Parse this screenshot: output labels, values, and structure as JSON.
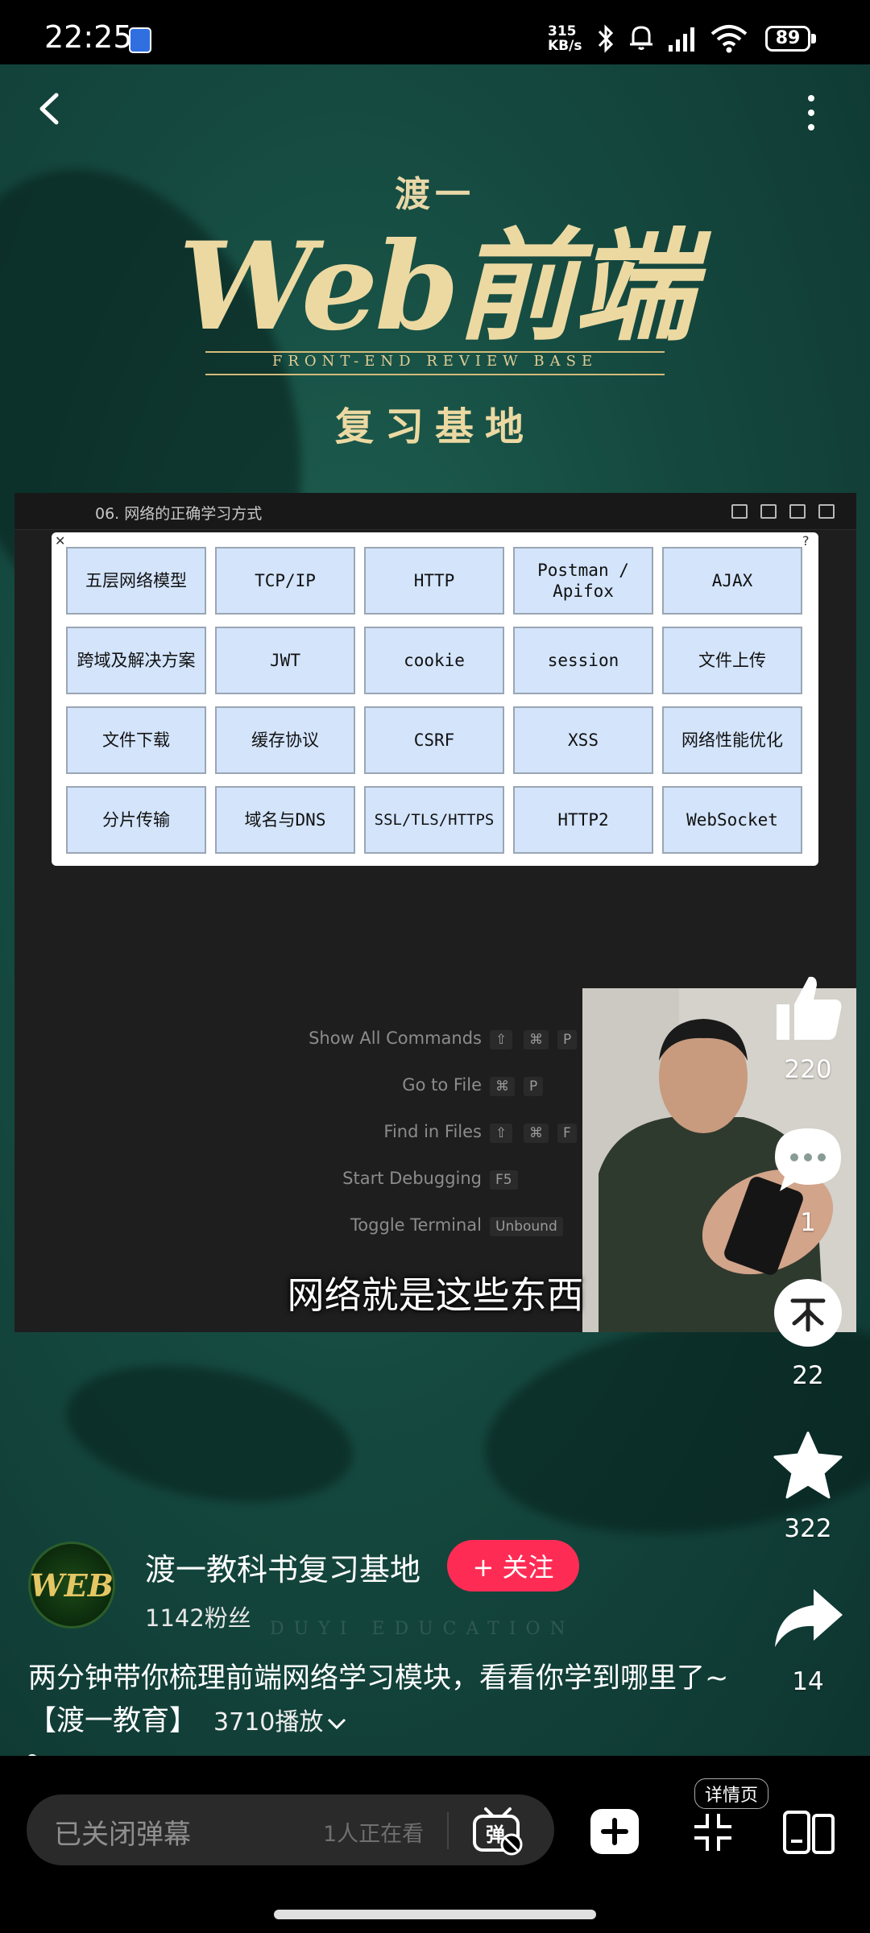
{
  "status_bar": {
    "time": "22:25",
    "net_speed_value": "315",
    "net_speed_unit": "KB/s",
    "battery": "89"
  },
  "video": {
    "brand_top": "渡一",
    "brand_main": "Web前端",
    "brand_sub": "FRONT-END REVIEW BASE",
    "brand_bottom": "复习基地",
    "screen_tab_title": "06. 网络的正确学习方式",
    "topics": [
      [
        "五层网络模型",
        "TCP/IP",
        "HTTP",
        "Postman / Apifox",
        "AJAX"
      ],
      [
        "跨域及解决方案",
        "JWT",
        "cookie",
        "session",
        "文件上传"
      ],
      [
        "文件下载",
        "缓存协议",
        "CSRF",
        "XSS",
        "网络性能优化"
      ],
      [
        "分片传输",
        "域名与DNS",
        "SSL/TLS/HTTPS",
        "HTTP2",
        "WebSocket"
      ]
    ],
    "commands": [
      {
        "label": "Show All Commands",
        "keys": [
          "⇧",
          "⌘",
          "P"
        ]
      },
      {
        "label": "Go to File",
        "keys": [
          "⌘",
          "P"
        ]
      },
      {
        "label": "Find in Files",
        "keys": [
          "⇧",
          "⌘",
          "F"
        ]
      },
      {
        "label": "Start Debugging",
        "keys": [
          "F5"
        ]
      },
      {
        "label": "Toggle Terminal",
        "keys": [
          "Unbound"
        ]
      }
    ],
    "subtitle": "网络就是这些东西",
    "watermark": "DUYI EDUCATION"
  },
  "actions": {
    "like_count": "220",
    "comment_count": "1",
    "coin_count": "22",
    "favorite_count": "322",
    "share_count": "14"
  },
  "author": {
    "avatar_text": "WEB",
    "name": "渡一教科书复习基地",
    "fans": "1142粉丝",
    "follow_label": "+ 关注"
  },
  "description": {
    "text": "两分钟带你梳理前端网络学习模块，看看你学到哪里了~【渡一教育】",
    "plays": "3710播放"
  },
  "playback": {
    "progress": 0.005
  },
  "bottom_bar": {
    "comment_placeholder": "已关闭弹幕",
    "watching": "1人正在看",
    "detail_label": "详情页"
  },
  "colors": {
    "follow": "#fe2c55",
    "topic_cell": "#d3e4fb",
    "stage_bg": "#154a40"
  }
}
